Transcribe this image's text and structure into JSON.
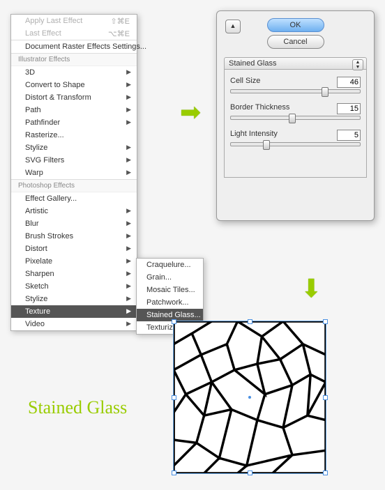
{
  "menu": {
    "applyLast": "Apply Last Effect",
    "applyLastKey": "⇧⌘E",
    "lastEffect": "Last Effect",
    "lastEffectKey": "⌥⌘E",
    "rasterSettings": "Document Raster Effects Settings...",
    "headerIllustrator": "Illustrator Effects",
    "illustrator": [
      "3D",
      "Convert to Shape",
      "Distort & Transform",
      "Path",
      "Pathfinder",
      "Rasterize...",
      "Stylize",
      "SVG Filters",
      "Warp"
    ],
    "headerPhotoshop": "Photoshop Effects",
    "photoshop": [
      "Effect Gallery...",
      "Artistic",
      "Blur",
      "Brush Strokes",
      "Distort",
      "Pixelate",
      "Sharpen",
      "Sketch",
      "Stylize",
      "Texture",
      "Video"
    ],
    "selectedPs": "Texture"
  },
  "submenu": {
    "items": [
      "Craquelure...",
      "Grain...",
      "Mosaic Tiles...",
      "Patchwork...",
      "Stained Glass...",
      "Texturizer..."
    ],
    "selected": "Stained Glass..."
  },
  "dialog": {
    "ok": "OK",
    "cancel": "Cancel",
    "tab": "Stained Glass",
    "params": [
      {
        "label": "Cell Size",
        "value": "46",
        "thumb": 70
      },
      {
        "label": "Border Thickness",
        "value": "15",
        "thumb": 45
      },
      {
        "label": "Light Intensity",
        "value": "5",
        "thumb": 25
      }
    ]
  },
  "resultLabel": "Stained Glass"
}
